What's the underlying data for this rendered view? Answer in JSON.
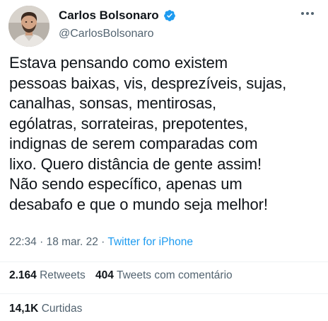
{
  "author": {
    "display_name": "Carlos Bolsonaro",
    "handle": "@CarlosBolsonaro",
    "verified": true,
    "avatar_icon": "profile-photo"
  },
  "tweet": {
    "lines": [
      "Estava pensando como existem",
      "pessoas baixas, vis, desprezíveis, sujas,",
      "canalhas, sonsas, mentirosas,",
      "ególatras, sorrateiras, prepotentes,",
      "indignas de serem comparadas com",
      "lixo. Quero distância de gente assim!",
      "Não sendo específico, apenas um",
      "desabafo e que o mundo seja melhor!"
    ]
  },
  "meta": {
    "time": "22:34",
    "sep1": " · ",
    "date": "18 mar. 22",
    "sep2": " · ",
    "source": "Twitter for iPhone"
  },
  "stats": {
    "retweets_count": "2.164",
    "retweets_label": "Retweets",
    "quotes_count": "404",
    "quotes_label": "Tweets com comentário",
    "likes_count": "14,1K",
    "likes_label": "Curtidas"
  },
  "colors": {
    "verified_blue": "#1d9bf0",
    "link_blue": "#1d9bf0",
    "secondary_text": "#536471",
    "primary_text": "#0f1419"
  }
}
